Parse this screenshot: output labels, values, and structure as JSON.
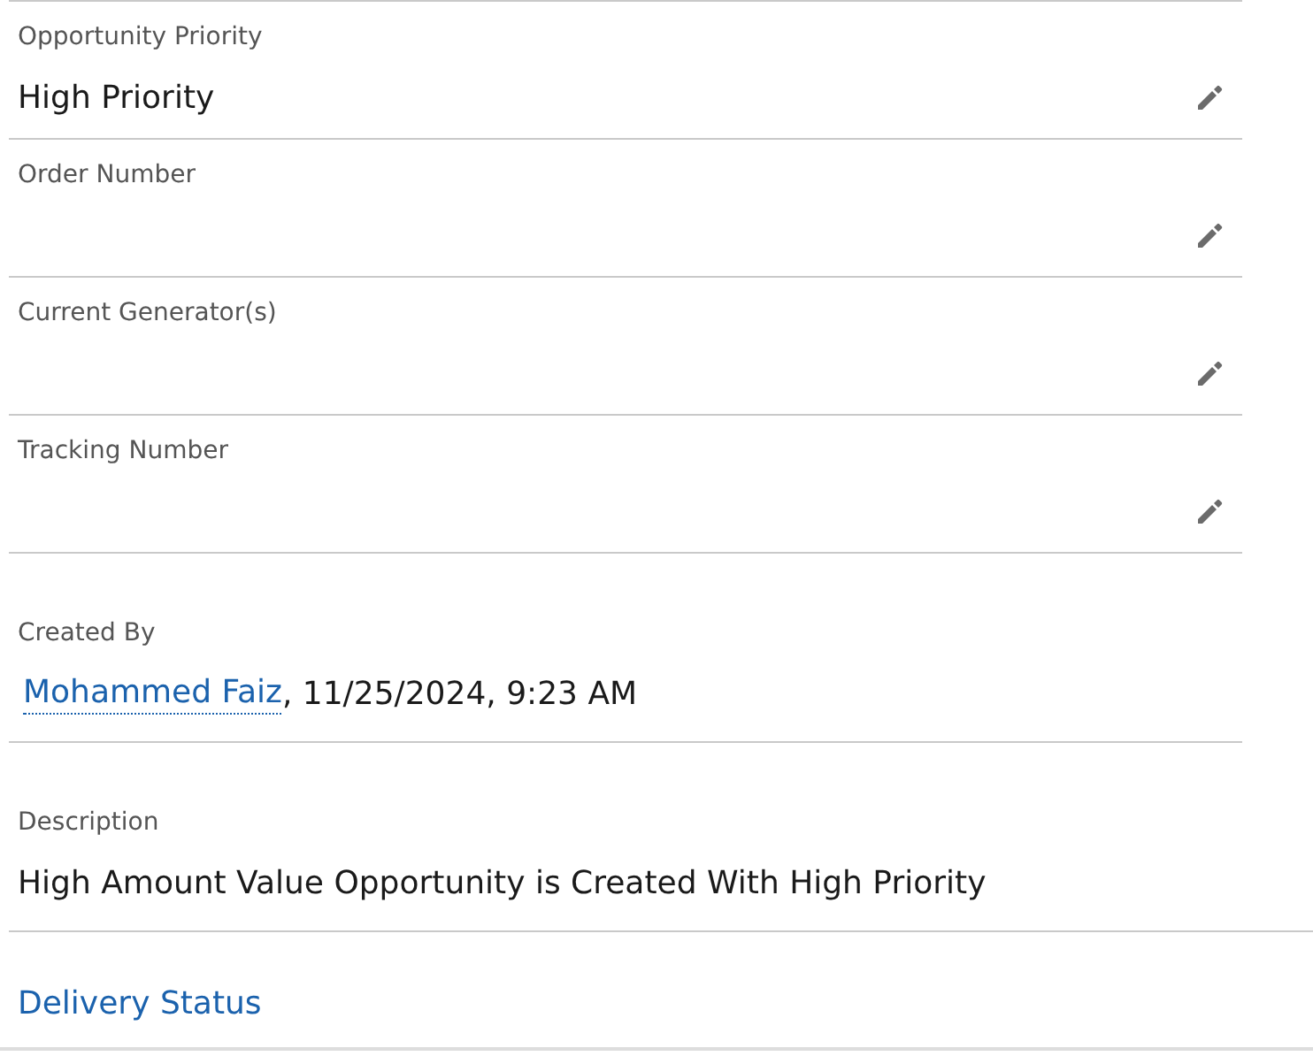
{
  "fields": [
    {
      "kind": "editable",
      "label": "Opportunity Priority",
      "value": "High Priority"
    },
    {
      "kind": "editable",
      "label": "Order Number"
    },
    {
      "kind": "editable",
      "label": "Current Generator(s)"
    },
    {
      "kind": "editable",
      "label": "Tracking Number"
    },
    {
      "kind": "created_by",
      "label": "Created By",
      "user": "Mohammed Faiz",
      "date": ", 11/25/2024, 9:23 AM"
    },
    {
      "kind": "readonly",
      "label": "Description",
      "value": "High Amount Value Opportunity is Created With High Priority"
    }
  ],
  "section": {
    "title": "Delivery Status"
  }
}
